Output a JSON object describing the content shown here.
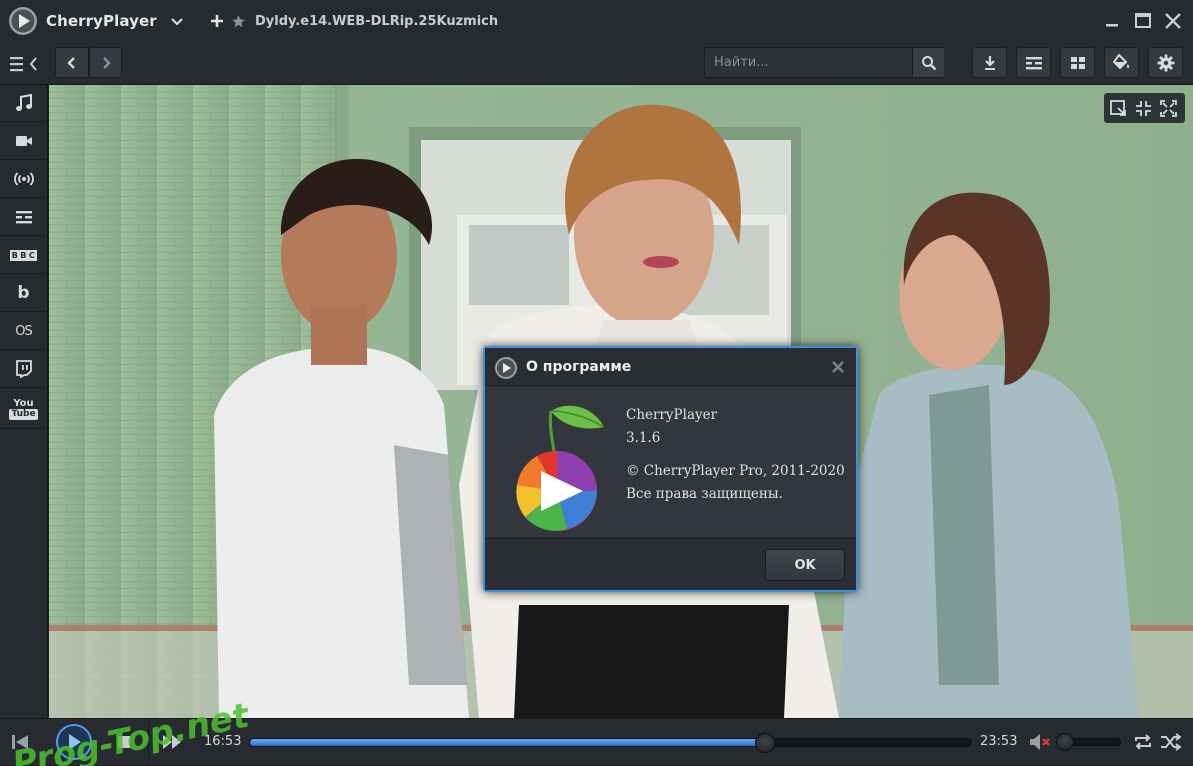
{
  "app": {
    "title": "CherryPlayer",
    "tab_title": "Dyldy.e14.WEB-DLRip.25Kuzmich"
  },
  "toolbar": {
    "search_placeholder": "Найти..."
  },
  "sidebar": {
    "items": [
      {
        "name": "music",
        "icon": "music-note-icon"
      },
      {
        "name": "video",
        "icon": "video-camera-icon"
      },
      {
        "name": "radio",
        "icon": "radio-broadcast-icon"
      },
      {
        "name": "tv",
        "icon": "tv-guide-icon"
      },
      {
        "name": "bbc",
        "icon": "bbc-icon",
        "label": "BBC"
      },
      {
        "name": "bandcamp",
        "icon": "b-icon",
        "label": "b"
      },
      {
        "name": "lastfm",
        "icon": "lastfm-icon",
        "label": "OS"
      },
      {
        "name": "twitch",
        "icon": "twitch-icon"
      },
      {
        "name": "youtube",
        "icon": "youtube-icon",
        "label": "You",
        "label2": "Tube"
      }
    ]
  },
  "player": {
    "elapsed": "16:53",
    "total": "23:53",
    "progress": 0.7147,
    "volume": 0.0,
    "muted": true
  },
  "dialog": {
    "title": "О программе",
    "product": "CherryPlayer",
    "version": "3.1.6",
    "copyright": "© CherryPlayer Pro, 2011-2020",
    "rights": "Все права защищены.",
    "ok_label": "OK"
  },
  "watermark": {
    "text": "Prog-Top.net"
  },
  "colors": {
    "accent": "#3f8fe0",
    "background": "#272b30",
    "seek_fill": "#4a8ee0"
  }
}
